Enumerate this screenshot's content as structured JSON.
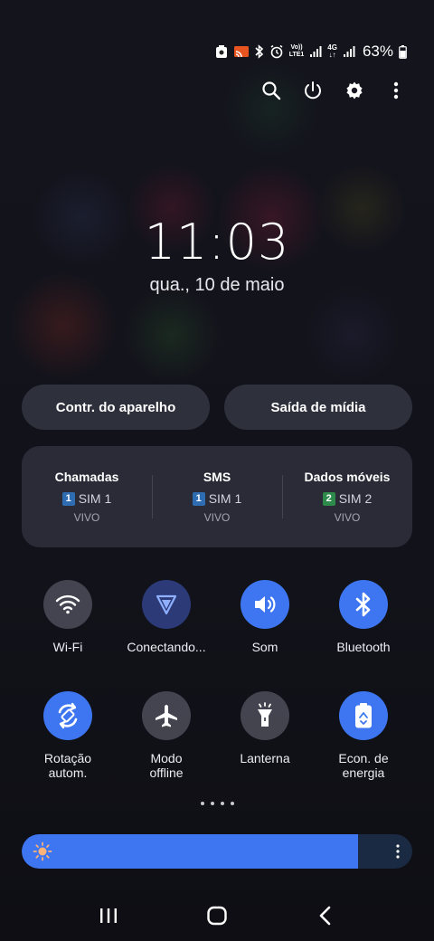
{
  "status_bar": {
    "battery_percent": "63%",
    "network_label_1": "LTE1",
    "network_label_2": "4G"
  },
  "top_actions": [
    "search-icon",
    "power-icon",
    "settings-icon",
    "more-vert-icon"
  ],
  "clock": {
    "time": "11:03",
    "date": "qua., 10 de maio"
  },
  "pills": {
    "device_control": "Contr. do aparelho",
    "media_output": "Saída de mídia"
  },
  "sim": {
    "columns": [
      {
        "title": "Chamadas",
        "badge": "1",
        "sim": "SIM 1",
        "carrier": "VIVO",
        "badge_color": "#2f6db3"
      },
      {
        "title": "SMS",
        "badge": "1",
        "sim": "SIM 1",
        "carrier": "VIVO",
        "badge_color": "#2f6db3"
      },
      {
        "title": "Dados móveis",
        "badge": "2",
        "sim": "SIM 2",
        "carrier": "VIVO",
        "badge_color": "#2e8a4a"
      }
    ]
  },
  "tiles": [
    {
      "label": "Wi-Fi",
      "icon": "wifi-icon",
      "state": "off"
    },
    {
      "label": "Conectando...",
      "icon": "cast-connecting-icon",
      "state": "connecting"
    },
    {
      "label": "Som",
      "icon": "volume-icon",
      "state": "on"
    },
    {
      "label": "Bluetooth",
      "icon": "bluetooth-icon",
      "state": "on"
    },
    {
      "label": "Rotação autom.",
      "label_line1": "Rotação",
      "label_line2": "autom.",
      "icon": "auto-rotate-icon",
      "state": "on"
    },
    {
      "label": "Modo offline",
      "label_line1": "Modo",
      "label_line2": "offline",
      "icon": "airplane-icon",
      "state": "off"
    },
    {
      "label": "Lanterna",
      "icon": "flashlight-icon",
      "state": "off"
    },
    {
      "label": "Econ. de energia",
      "label_line1": "Econ. de",
      "label_line2": "energia",
      "icon": "power-saving-icon",
      "state": "on"
    }
  ],
  "brightness": {
    "level": 0.86
  },
  "colors": {
    "accent": "#3d76f0",
    "tile_off": "#545662"
  }
}
